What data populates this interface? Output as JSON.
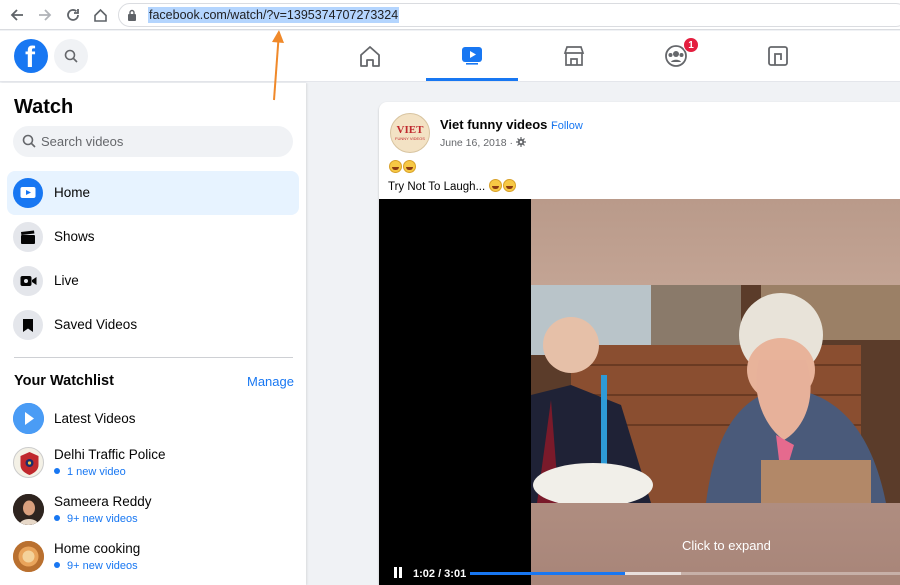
{
  "browser": {
    "url": "facebook.com/watch/?v=1395374707273324"
  },
  "topnav": {
    "groups_badge": "1"
  },
  "sidebar": {
    "title": "Watch",
    "search_placeholder": "Search videos",
    "items": [
      {
        "label": "Home",
        "icon": "watch-play-icon",
        "active": true
      },
      {
        "label": "Shows",
        "icon": "clapperboard-icon"
      },
      {
        "label": "Live",
        "icon": "camera-icon"
      },
      {
        "label": "Saved Videos",
        "icon": "bookmark-icon"
      }
    ],
    "watchlist_title": "Your Watchlist",
    "manage_label": "Manage",
    "watchlist": [
      {
        "name": "Latest Videos",
        "sub": ""
      },
      {
        "name": "Delhi Traffic Police",
        "sub": "1 new video"
      },
      {
        "name": "Sameera Reddy",
        "sub": "9+ new videos"
      },
      {
        "name": "Home cooking",
        "sub": "9+ new videos"
      }
    ]
  },
  "post": {
    "page_name": "Viet funny videos",
    "separator": "·",
    "follow_label": "Follow",
    "date": "June 16, 2018 · ",
    "avatar_text": "VIET",
    "avatar_subtext": "FUNNY VIDEOS",
    "caption": "Try Not To Laugh... "
  },
  "video": {
    "time": "1:02 / 3:01",
    "progress_played": 0.36,
    "progress_buffered": 0.49,
    "expand_label": "Click to expand"
  },
  "colors": {
    "accent": "#1877f2",
    "badge": "#e41e3f",
    "annotation": "#f0892a"
  }
}
